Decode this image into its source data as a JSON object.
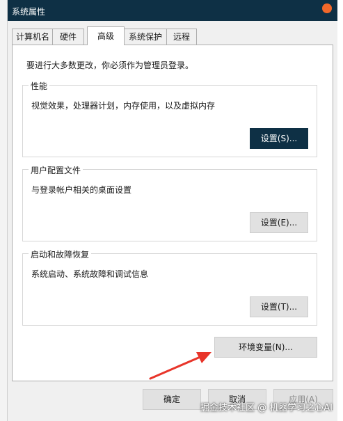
{
  "window": {
    "title": "系统属性"
  },
  "tabs": [
    {
      "label": "计算机名",
      "active": false
    },
    {
      "label": "硬件",
      "active": false
    },
    {
      "label": "高级",
      "active": true
    },
    {
      "label": "系统保护",
      "active": false
    },
    {
      "label": "远程",
      "active": false
    }
  ],
  "admin_note": "要进行大多数更改，你必须作为管理员登录。",
  "performance": {
    "title": "性能",
    "desc": "视觉效果，处理器计划，内存使用，以及虚拟内存",
    "button": "设置(S)..."
  },
  "user_profiles": {
    "title": "用户配置文件",
    "desc": "与登录帐户相关的桌面设置",
    "button": "设置(E)..."
  },
  "startup": {
    "title": "启动和故障恢复",
    "desc": "系统启动、系统故障和调试信息",
    "button": "设置(T)..."
  },
  "env_button": "环境变量(N)...",
  "footer": {
    "ok": "确定",
    "cancel": "取消",
    "apply": "应用(A)"
  },
  "watermark": "掘金技术社区 @ 机器学习之心AI",
  "colors": {
    "titlebar": "#0e3045",
    "close": "#f2682a",
    "arrow": "#e8352a"
  }
}
